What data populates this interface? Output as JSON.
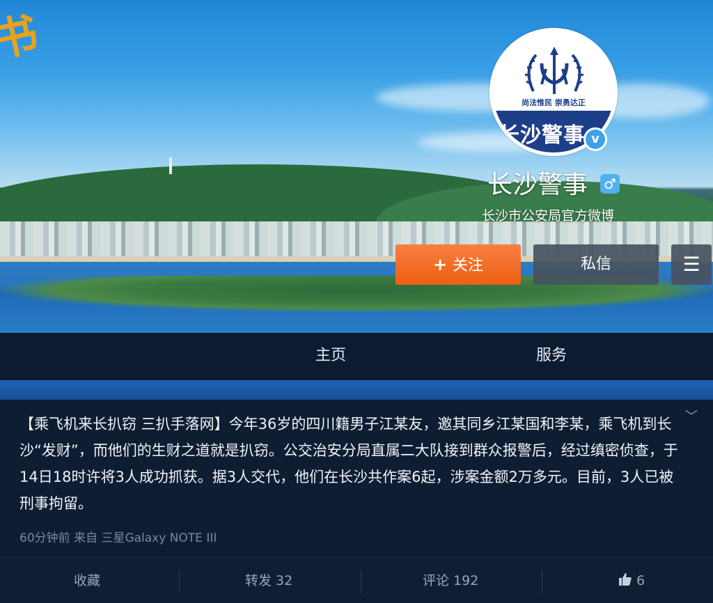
{
  "profile": {
    "name": "长沙警事",
    "description": "长沙市公安局官方微博",
    "avatar_slogan": "尚法惟民 崇勇达正",
    "avatar_band_text": "长沙警事",
    "verified_glyph": "v",
    "gender_glyph": "♂"
  },
  "actions": {
    "follow_plus": "+",
    "follow_label": "关注",
    "message_label": "私信",
    "menu_glyph": "☰"
  },
  "tabs": [
    {
      "label": "主页"
    },
    {
      "label": "服务"
    }
  ],
  "post": {
    "text": "【乘飞机来长扒窃 三扒手落网】今年36岁的四川籍男子江某友，邀其同乡江某国和李某，乘飞机到长沙“发财”，而他们的生财之道就是扒窃。公交治安分局直属二大队接到群众报警后，经过缜密侦查，于14日18时许将3人成功抓获。据3人交代，他们在长沙共作案6起，涉案金额2万多元。目前，3人已被刑事拘留。",
    "meta": "60分钟前 来自 三星Galaxy NOTE III",
    "chevron_glyph": "﹀"
  },
  "post_actions": {
    "favorite": "收藏",
    "repost": "转发 32",
    "comment": "评论 192",
    "like_count": "6"
  },
  "colors": {
    "follow": "#ee5f14",
    "tabbar": "#0d1b31",
    "card": "#0f1d33",
    "verified": "#3da2e8"
  },
  "icons": {
    "verified": "verified-badge-icon",
    "gender": "male-icon",
    "menu": "hamburger-menu-icon",
    "like": "thumbs-up-icon",
    "expand": "chevron-down-icon"
  }
}
